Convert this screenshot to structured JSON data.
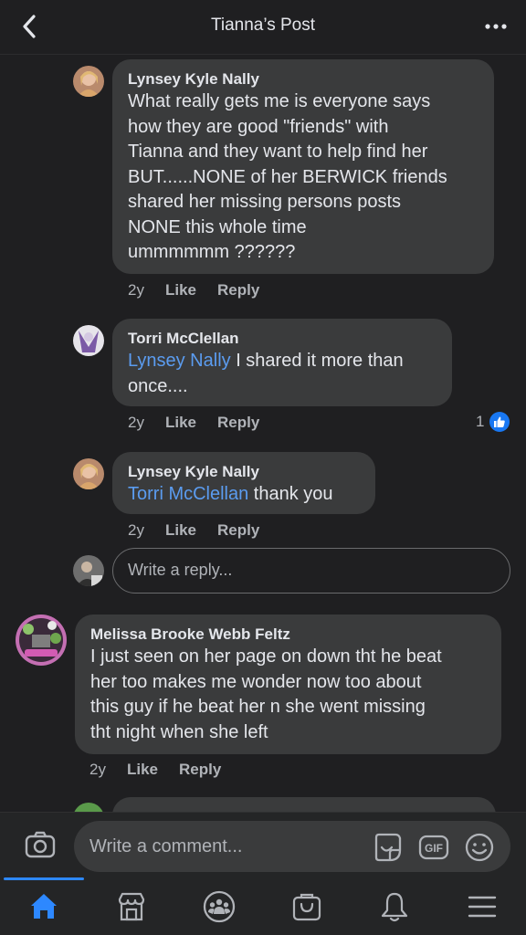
{
  "header": {
    "title": "Tianna’s Post",
    "back_icon": "chevron-left-icon",
    "more_icon": "more-dots-icon"
  },
  "comments": [
    {
      "author": "Lynsey Kyle Nally",
      "lines": [
        "What really gets me is everyone says",
        "how they are good \"friends\" with",
        "Tianna and they want to help find her",
        "BUT......NONE of her BERWICK friends",
        "shared her missing persons posts",
        "NONE this whole time",
        "ummmmmm ??????"
      ],
      "time": "2y",
      "like": "Like",
      "reply": "Reply"
    },
    {
      "author": "Torri McClellan",
      "mention": "Lynsey Nally",
      "line1_rest": " I shared it more than",
      "line2": "once....",
      "time": "2y",
      "like": "Like",
      "reply": "Reply",
      "reaction_count": "1"
    },
    {
      "author": "Lynsey Kyle Nally",
      "mention": "Torri McClellan",
      "text_rest": " thank you",
      "time": "2y",
      "like": "Like",
      "reply": "Reply"
    },
    {
      "author": "Melissa Brooke Webb Feltz",
      "lines": [
        "I just seen on her page on down tht he beat",
        "her too makes me wonder now too about",
        "this guy if he beat her n she went missing",
        "tht night when she left"
      ],
      "time": "2y",
      "like": "Like",
      "reply": "Reply"
    }
  ],
  "reply_box": {
    "placeholder": "Write a reply..."
  },
  "composer": {
    "placeholder": "Write a comment...",
    "gif_label": "GIF"
  },
  "colors": {
    "accent": "#2d88ff",
    "mention": "#5b9cf0",
    "bubble": "#3a3b3c",
    "background": "#1f1f21"
  },
  "tabs": [
    "home-icon",
    "marketplace-icon",
    "groups-icon",
    "shop-icon",
    "notifications-icon",
    "menu-icon"
  ]
}
